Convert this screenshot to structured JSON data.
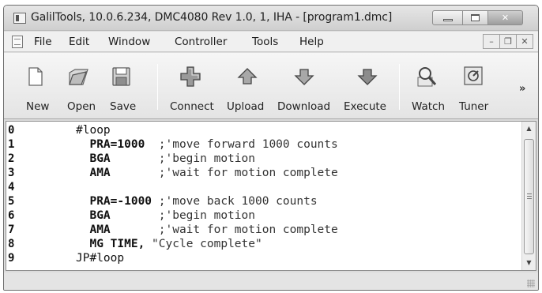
{
  "window": {
    "title": "GalilTools, 10.0.6.234, DMC4080 Rev 1.0, 1, IHA - [program1.dmc]"
  },
  "menu": {
    "items": [
      "File",
      "Edit",
      "Window",
      "Controller",
      "Tools",
      "Help"
    ]
  },
  "toolbar": {
    "buttons": [
      {
        "label": "New",
        "icon": "new-document-icon"
      },
      {
        "label": "Open",
        "icon": "open-folder-icon"
      },
      {
        "label": "Save",
        "icon": "floppy-disk-icon"
      },
      {
        "label": "Connect",
        "icon": "connect-plus-icon"
      },
      {
        "label": "Upload",
        "icon": "upload-arrow-icon"
      },
      {
        "label": "Download",
        "icon": "download-arrow-icon"
      },
      {
        "label": "Execute",
        "icon": "execute-arrow-icon"
      },
      {
        "label": "Watch",
        "icon": "magnifier-watch-icon"
      },
      {
        "label": "Tuner",
        "icon": "tuner-icon"
      }
    ],
    "overflow": "»"
  },
  "editor": {
    "line_numbers": [
      "0",
      "1",
      "2",
      "3",
      "4",
      "5",
      "6",
      "7",
      "8",
      "9"
    ],
    "lines": [
      {
        "cmd": "#loop",
        "comment": ""
      },
      {
        "cmd": "  PRA=1000",
        "comment": "  ;'move forward 1000 counts"
      },
      {
        "cmd": "  BGA",
        "comment": "       ;'begin motion"
      },
      {
        "cmd": "  AMA",
        "comment": "       ;'wait for motion complete"
      },
      {
        "cmd": "",
        "comment": ""
      },
      {
        "cmd": "  PRA=-1000",
        "comment": " ;'move back 1000 counts"
      },
      {
        "cmd": "  BGA",
        "comment": "       ;'begin motion"
      },
      {
        "cmd": "  AMA",
        "comment": "       ;'wait for motion complete"
      },
      {
        "cmd": "  MG TIME,",
        "comment": " \"Cycle complete\""
      },
      {
        "cmd": "JP#loop",
        "comment": ""
      }
    ]
  },
  "colors": {
    "chrome": "#dcdcdc",
    "editor_bg": "#ffffff",
    "text": "#111111"
  }
}
